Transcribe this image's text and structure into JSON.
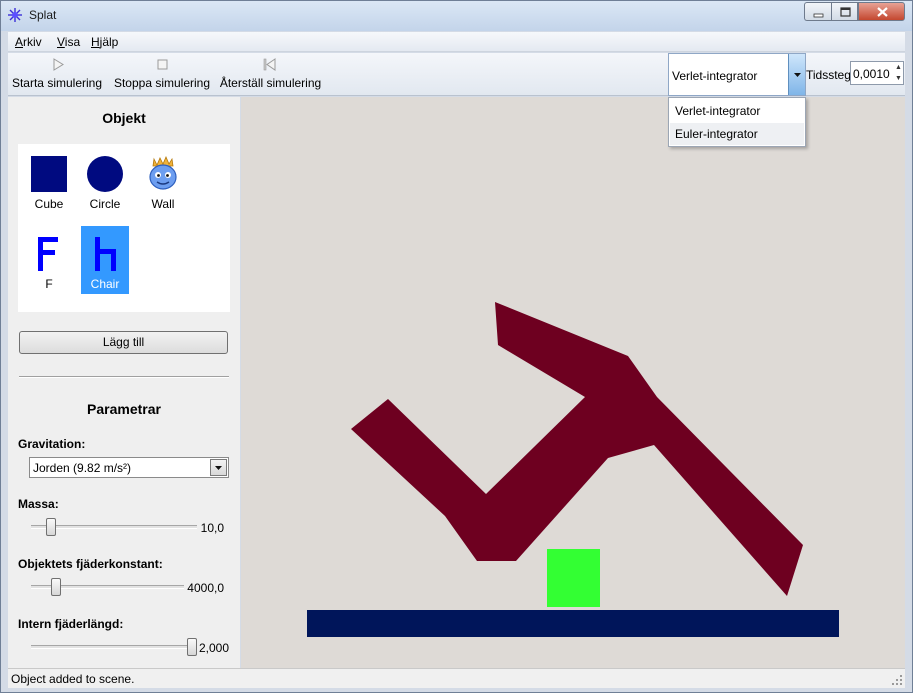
{
  "window": {
    "title": "Splat"
  },
  "menu": [
    {
      "key": "A",
      "rest": "rkiv"
    },
    {
      "key": "V",
      "rest": "isa"
    },
    {
      "key": "H",
      "rest": "jälp"
    }
  ],
  "toolbar": {
    "start_label": "Starta simulering",
    "stop_label": "Stoppa simulering",
    "reset_label": "Återställ simulering",
    "integrator": {
      "selected": "Verlet-integrator",
      "options": [
        "Verlet-integrator",
        "Euler-integrator"
      ],
      "expanded": true,
      "highlighted_option": "Euler-integrator"
    },
    "timestep_label": "Tidssteg",
    "timestep_value": "0,0010"
  },
  "objects_panel": {
    "heading": "Objekt",
    "items": [
      {
        "label": "Cube",
        "icon": "square-icon",
        "color": "#000a80",
        "selected": false
      },
      {
        "label": "Circle",
        "icon": "circle-icon",
        "color": "#000a80",
        "selected": false
      },
      {
        "label": "Wall",
        "icon": "blob-monster-icon",
        "color": "#5e8ee6",
        "selected": false
      },
      {
        "label": "F",
        "icon": "letter-f-shape-icon",
        "color": "#0000ff",
        "selected": false
      },
      {
        "label": "Chair",
        "icon": "chair-shape-icon",
        "color": "#0000ff",
        "selected": true
      }
    ],
    "add_button_label": "Lägg till"
  },
  "parameters": {
    "heading": "Parametrar",
    "gravity": {
      "label": "Gravitation:",
      "value": "Jorden (9.82 m/s²)"
    },
    "mass": {
      "label": "Massa:",
      "value": "10,0",
      "level": 0.1
    },
    "spring_constant": {
      "label": "Objektets fjäderkonstant:",
      "value": "4000,0",
      "level": 0.1
    },
    "internal_spring_length": {
      "label": "Intern fjäderlängd:",
      "value": "2,000",
      "level": 1.0
    }
  },
  "scene": {
    "background": "#dedad6",
    "objects": [
      {
        "kind": "chair",
        "color": "#6e0020"
      },
      {
        "kind": "cube",
        "color": "#33ff33"
      },
      {
        "kind": "ground-wall",
        "color": "#00155a"
      }
    ]
  },
  "status": {
    "text": "Object added to scene."
  }
}
